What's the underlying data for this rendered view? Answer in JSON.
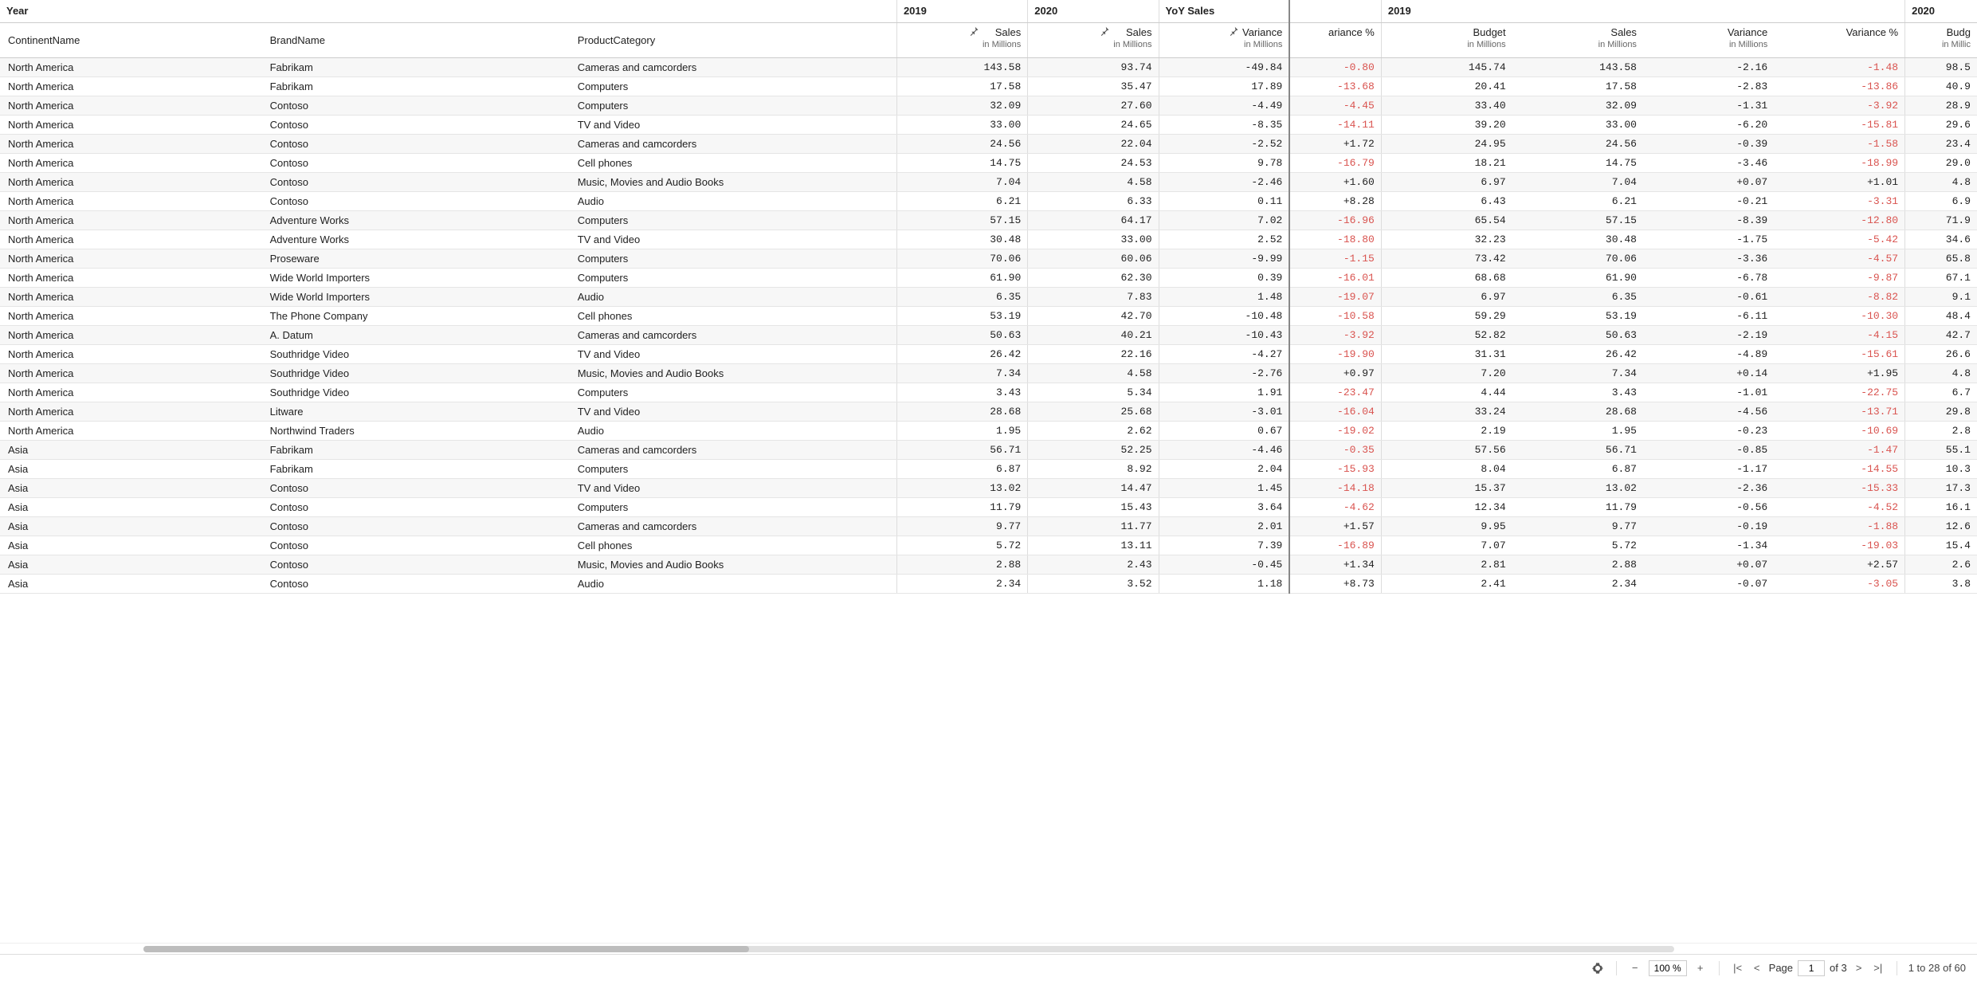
{
  "header": {
    "year_label": "Year",
    "dims": [
      "ContinentName",
      "BrandName",
      "ProductCategory"
    ],
    "groups": [
      {
        "label": "2019",
        "cols": [
          {
            "title": "Sales",
            "sub": "in Millions",
            "pin": true
          }
        ]
      },
      {
        "label": "2020",
        "cols": [
          {
            "title": "Sales",
            "sub": "in Millions",
            "pin": true
          }
        ]
      },
      {
        "label": "YoY Sales",
        "cols": [
          {
            "title": "Variance",
            "sub": "in Millions",
            "pin": true
          }
        ]
      },
      {
        "label": "",
        "cols": [
          {
            "title": "ariance %",
            "sub": "",
            "pin": false,
            "cut": true
          }
        ]
      },
      {
        "label": "2019",
        "cols": [
          {
            "title": "Budget",
            "sub": "in Millions",
            "pin": false
          },
          {
            "title": "Sales",
            "sub": "in Millions",
            "pin": false
          },
          {
            "title": "Variance",
            "sub": "in Millions",
            "pin": false
          },
          {
            "title": "Variance %",
            "sub": "",
            "pin": false
          }
        ]
      },
      {
        "label": "2020",
        "cols": [
          {
            "title": "Budg",
            "sub": "in Millic",
            "pin": false,
            "cut": true
          }
        ]
      }
    ]
  },
  "rows": [
    {
      "c": "North America",
      "b": "Fabrikam",
      "p": "Cameras and camcorders",
      "s19": "143.58",
      "s20": "93.74",
      "yoy": "-49.84",
      "yoypct": "-0.80",
      "bud19": "145.74",
      "sal19": "143.58",
      "var19": "-2.16",
      "varp19": "-1.48",
      "b20": "98.5"
    },
    {
      "c": "North America",
      "b": "Fabrikam",
      "p": "Computers",
      "s19": "17.58",
      "s20": "35.47",
      "yoy": "17.89",
      "yoypct": "-13.68",
      "bud19": "20.41",
      "sal19": "17.58",
      "var19": "-2.83",
      "varp19": "-13.86",
      "b20": "40.9"
    },
    {
      "c": "North America",
      "b": "Contoso",
      "p": "Computers",
      "s19": "32.09",
      "s20": "27.60",
      "yoy": "-4.49",
      "yoypct": "-4.45",
      "bud19": "33.40",
      "sal19": "32.09",
      "var19": "-1.31",
      "varp19": "-3.92",
      "b20": "28.9"
    },
    {
      "c": "North America",
      "b": "Contoso",
      "p": "TV and Video",
      "s19": "33.00",
      "s20": "24.65",
      "yoy": "-8.35",
      "yoypct": "-14.11",
      "bud19": "39.20",
      "sal19": "33.00",
      "var19": "-6.20",
      "varp19": "-15.81",
      "b20": "29.6"
    },
    {
      "c": "North America",
      "b": "Contoso",
      "p": "Cameras and camcorders",
      "s19": "24.56",
      "s20": "22.04",
      "yoy": "-2.52",
      "yoypct": "+1.72",
      "bud19": "24.95",
      "sal19": "24.56",
      "var19": "-0.39",
      "varp19": "-1.58",
      "b20": "23.4"
    },
    {
      "c": "North America",
      "b": "Contoso",
      "p": "Cell phones",
      "s19": "14.75",
      "s20": "24.53",
      "yoy": "9.78",
      "yoypct": "-16.79",
      "bud19": "18.21",
      "sal19": "14.75",
      "var19": "-3.46",
      "varp19": "-18.99",
      "b20": "29.0"
    },
    {
      "c": "North America",
      "b": "Contoso",
      "p": "Music, Movies and Audio Books",
      "s19": "7.04",
      "s20": "4.58",
      "yoy": "-2.46",
      "yoypct": "+1.60",
      "bud19": "6.97",
      "sal19": "7.04",
      "var19": "+0.07",
      "varp19": "+1.01",
      "b20": "4.8"
    },
    {
      "c": "North America",
      "b": "Contoso",
      "p": "Audio",
      "s19": "6.21",
      "s20": "6.33",
      "yoy": "0.11",
      "yoypct": "+8.28",
      "bud19": "6.43",
      "sal19": "6.21",
      "var19": "-0.21",
      "varp19": "-3.31",
      "b20": "6.9"
    },
    {
      "c": "North America",
      "b": "Adventure Works",
      "p": "Computers",
      "s19": "57.15",
      "s20": "64.17",
      "yoy": "7.02",
      "yoypct": "-16.96",
      "bud19": "65.54",
      "sal19": "57.15",
      "var19": "-8.39",
      "varp19": "-12.80",
      "b20": "71.9"
    },
    {
      "c": "North America",
      "b": "Adventure Works",
      "p": "TV and Video",
      "s19": "30.48",
      "s20": "33.00",
      "yoy": "2.52",
      "yoypct": "-18.80",
      "bud19": "32.23",
      "sal19": "30.48",
      "var19": "-1.75",
      "varp19": "-5.42",
      "b20": "34.6"
    },
    {
      "c": "North America",
      "b": "Proseware",
      "p": "Computers",
      "s19": "70.06",
      "s20": "60.06",
      "yoy": "-9.99",
      "yoypct": "-1.15",
      "bud19": "73.42",
      "sal19": "70.06",
      "var19": "-3.36",
      "varp19": "-4.57",
      "b20": "65.8"
    },
    {
      "c": "North America",
      "b": "Wide World Importers",
      "p": "Computers",
      "s19": "61.90",
      "s20": "62.30",
      "yoy": "0.39",
      "yoypct": "-16.01",
      "bud19": "68.68",
      "sal19": "61.90",
      "var19": "-6.78",
      "varp19": "-9.87",
      "b20": "67.1"
    },
    {
      "c": "North America",
      "b": "Wide World Importers",
      "p": "Audio",
      "s19": "6.35",
      "s20": "7.83",
      "yoy": "1.48",
      "yoypct": "-19.07",
      "bud19": "6.97",
      "sal19": "6.35",
      "var19": "-0.61",
      "varp19": "-8.82",
      "b20": "9.1"
    },
    {
      "c": "North America",
      "b": "The Phone Company",
      "p": "Cell phones",
      "s19": "53.19",
      "s20": "42.70",
      "yoy": "-10.48",
      "yoypct": "-10.58",
      "bud19": "59.29",
      "sal19": "53.19",
      "var19": "-6.11",
      "varp19": "-10.30",
      "b20": "48.4"
    },
    {
      "c": "North America",
      "b": "A. Datum",
      "p": "Cameras and camcorders",
      "s19": "50.63",
      "s20": "40.21",
      "yoy": "-10.43",
      "yoypct": "-3.92",
      "bud19": "52.82",
      "sal19": "50.63",
      "var19": "-2.19",
      "varp19": "-4.15",
      "b20": "42.7"
    },
    {
      "c": "North America",
      "b": "Southridge Video",
      "p": "TV and Video",
      "s19": "26.42",
      "s20": "22.16",
      "yoy": "-4.27",
      "yoypct": "-19.90",
      "bud19": "31.31",
      "sal19": "26.42",
      "var19": "-4.89",
      "varp19": "-15.61",
      "b20": "26.6"
    },
    {
      "c": "North America",
      "b": "Southridge Video",
      "p": "Music, Movies and Audio Books",
      "s19": "7.34",
      "s20": "4.58",
      "yoy": "-2.76",
      "yoypct": "+0.97",
      "bud19": "7.20",
      "sal19": "7.34",
      "var19": "+0.14",
      "varp19": "+1.95",
      "b20": "4.8"
    },
    {
      "c": "North America",
      "b": "Southridge Video",
      "p": "Computers",
      "s19": "3.43",
      "s20": "5.34",
      "yoy": "1.91",
      "yoypct": "-23.47",
      "bud19": "4.44",
      "sal19": "3.43",
      "var19": "-1.01",
      "varp19": "-22.75",
      "b20": "6.7"
    },
    {
      "c": "North America",
      "b": "Litware",
      "p": "TV and Video",
      "s19": "28.68",
      "s20": "25.68",
      "yoy": "-3.01",
      "yoypct": "-16.04",
      "bud19": "33.24",
      "sal19": "28.68",
      "var19": "-4.56",
      "varp19": "-13.71",
      "b20": "29.8"
    },
    {
      "c": "North America",
      "b": "Northwind Traders",
      "p": "Audio",
      "s19": "1.95",
      "s20": "2.62",
      "yoy": "0.67",
      "yoypct": "-19.02",
      "bud19": "2.19",
      "sal19": "1.95",
      "var19": "-0.23",
      "varp19": "-10.69",
      "b20": "2.8"
    },
    {
      "c": "Asia",
      "b": "Fabrikam",
      "p": "Cameras and camcorders",
      "s19": "56.71",
      "s20": "52.25",
      "yoy": "-4.46",
      "yoypct": "-0.35",
      "bud19": "57.56",
      "sal19": "56.71",
      "var19": "-0.85",
      "varp19": "-1.47",
      "b20": "55.1"
    },
    {
      "c": "Asia",
      "b": "Fabrikam",
      "p": "Computers",
      "s19": "6.87",
      "s20": "8.92",
      "yoy": "2.04",
      "yoypct": "-15.93",
      "bud19": "8.04",
      "sal19": "6.87",
      "var19": "-1.17",
      "varp19": "-14.55",
      "b20": "10.3"
    },
    {
      "c": "Asia",
      "b": "Contoso",
      "p": "TV and Video",
      "s19": "13.02",
      "s20": "14.47",
      "yoy": "1.45",
      "yoypct": "-14.18",
      "bud19": "15.37",
      "sal19": "13.02",
      "var19": "-2.36",
      "varp19": "-15.33",
      "b20": "17.3"
    },
    {
      "c": "Asia",
      "b": "Contoso",
      "p": "Computers",
      "s19": "11.79",
      "s20": "15.43",
      "yoy": "3.64",
      "yoypct": "-4.62",
      "bud19": "12.34",
      "sal19": "11.79",
      "var19": "-0.56",
      "varp19": "-4.52",
      "b20": "16.1"
    },
    {
      "c": "Asia",
      "b": "Contoso",
      "p": "Cameras and camcorders",
      "s19": "9.77",
      "s20": "11.77",
      "yoy": "2.01",
      "yoypct": "+1.57",
      "bud19": "9.95",
      "sal19": "9.77",
      "var19": "-0.19",
      "varp19": "-1.88",
      "b20": "12.6"
    },
    {
      "c": "Asia",
      "b": "Contoso",
      "p": "Cell phones",
      "s19": "5.72",
      "s20": "13.11",
      "yoy": "7.39",
      "yoypct": "-16.89",
      "bud19": "7.07",
      "sal19": "5.72",
      "var19": "-1.34",
      "varp19": "-19.03",
      "b20": "15.4"
    },
    {
      "c": "Asia",
      "b": "Contoso",
      "p": "Music, Movies and Audio Books",
      "s19": "2.88",
      "s20": "2.43",
      "yoy": "-0.45",
      "yoypct": "+1.34",
      "bud19": "2.81",
      "sal19": "2.88",
      "var19": "+0.07",
      "varp19": "+2.57",
      "b20": "2.6"
    },
    {
      "c": "Asia",
      "b": "Contoso",
      "p": "Audio",
      "s19": "2.34",
      "s20": "3.52",
      "yoy": "1.18",
      "yoypct": "+8.73",
      "bud19": "2.41",
      "sal19": "2.34",
      "var19": "-0.07",
      "varp19": "-3.05",
      "b20": "3.8"
    }
  ],
  "status": {
    "zoom": "100 %",
    "page_label": "Page",
    "page": "1",
    "total_pages": "of 3",
    "range": "1 to 28 of 60"
  }
}
